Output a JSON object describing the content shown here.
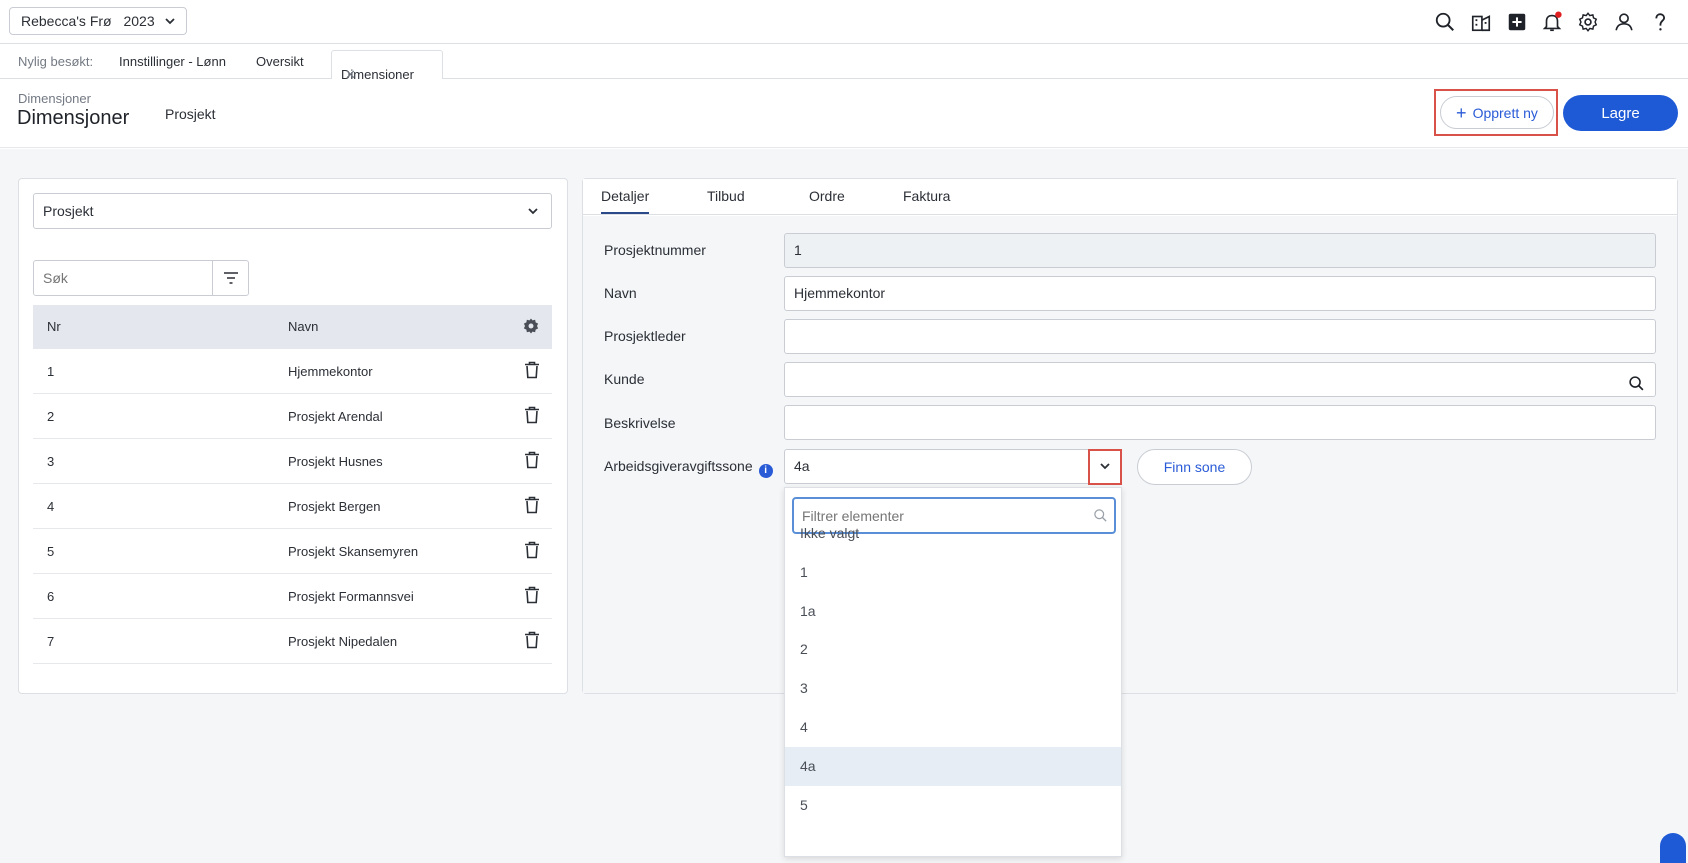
{
  "topbar": {
    "company": "Rebecca's Frø",
    "year": "2023"
  },
  "recent": {
    "label": "Nylig besøkt:",
    "links": [
      "Innstillinger - Lønn",
      "Oversikt"
    ],
    "active_tab": "Dimensjoner"
  },
  "header": {
    "subtitle": "Dimensjoner",
    "title": "Dimensjoner",
    "crumb": "Prosjekt",
    "new_button": "Opprett ny",
    "save_button": "Lagre"
  },
  "left": {
    "dimension_select": "Prosjekt",
    "search_placeholder": "Søk",
    "columns": [
      "Nr",
      "Navn"
    ],
    "rows": [
      {
        "nr": "1",
        "name": "Hjemmekontor"
      },
      {
        "nr": "2",
        "name": "Prosjekt Arendal"
      },
      {
        "nr": "3",
        "name": "Prosjekt Husnes"
      },
      {
        "nr": "4",
        "name": "Prosjekt Bergen"
      },
      {
        "nr": "5",
        "name": "Prosjekt Skansemyren"
      },
      {
        "nr": "6",
        "name": "Prosjekt Formannsvei"
      },
      {
        "nr": "7",
        "name": "Prosjekt Nipedalen"
      }
    ]
  },
  "right": {
    "tabs": [
      "Detaljer",
      "Tilbud",
      "Ordre",
      "Faktura"
    ],
    "fields": {
      "prosjektnummer_label": "Prosjektnummer",
      "prosjektnummer_value": "1",
      "navn_label": "Navn",
      "navn_value": "Hjemmekontor",
      "prosjektleder_label": "Prosjektleder",
      "prosjektleder_value": "",
      "kunde_label": "Kunde",
      "kunde_value": "",
      "beskrivelse_label": "Beskrivelse",
      "beskrivelse_value": "",
      "sone_label": "Arbeidsgiveravgiftssone",
      "sone_value": "4a",
      "finn_sone": "Finn sone"
    },
    "dropdown": {
      "filter_placeholder": "Filtrer elementer",
      "options": [
        "Ikke valgt",
        "1",
        "1a",
        "2",
        "3",
        "4",
        "4a",
        "5"
      ],
      "selected": "4a"
    }
  },
  "colors": {
    "primary": "#1f5ad6",
    "highlight": "#d9524a",
    "notification": "#e02020"
  }
}
